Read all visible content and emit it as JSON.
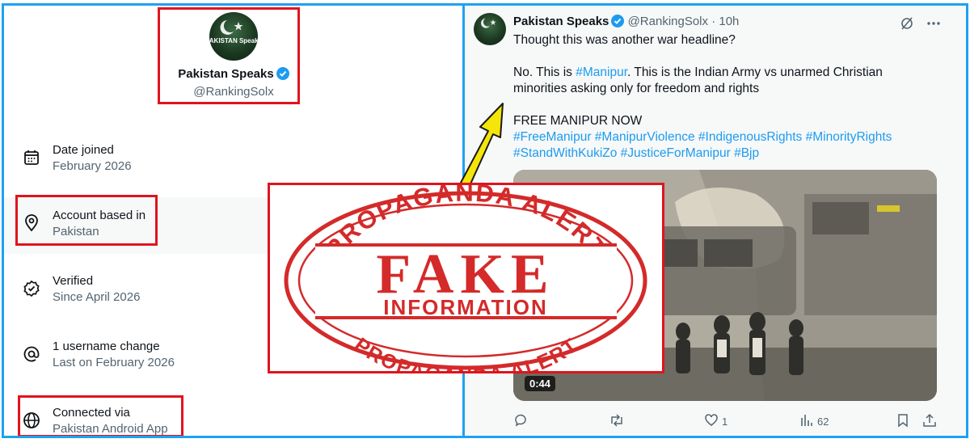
{
  "profile": {
    "avatar_text": "PAKISTAN Speaks",
    "name": "Pakistan Speaks",
    "handle": "@RankingSolx"
  },
  "about_rows": [
    {
      "icon": "calendar-icon",
      "label": "Date joined",
      "value": "February 2026"
    },
    {
      "icon": "location-pin-icon",
      "label": "Account based in",
      "value": "Pakistan"
    },
    {
      "icon": "verified-check-icon",
      "label": "Verified",
      "value": "Since April 2026"
    },
    {
      "icon": "at-sign-icon",
      "label": "1 username change",
      "value": "Last on February 2026"
    },
    {
      "icon": "globe-icon",
      "label": "Connected via",
      "value": "Pakistan Android App"
    }
  ],
  "tweet": {
    "name": "Pakistan Speaks",
    "handle": "@RankingSolx",
    "separator": "·",
    "time": "10h",
    "line1": "Thought this was another war headline?",
    "line2_pre": "No. This is ",
    "line2_tag": "#Manipur",
    "line2_post": ". This is the Indian Army vs unarmed Christian",
    "line3": "minorities asking only for freedom and rights",
    "line4": "FREE MANIPUR NOW",
    "hashtags_line1": "#FreeManipur #ManipurViolence #IndigenousRights #MinorityRights",
    "hashtags_line2": "#StandWithKukiZo #JusticeForManipur #Bjp",
    "video_duration": "0:44",
    "likes": "1",
    "views": "62"
  },
  "stamp": {
    "top_arc": "PROPAGANDA ALERT",
    "main": "FAKE",
    "sub": "INFORMATION",
    "bottom_arc": "PROPAGANDA ALERT"
  },
  "colors": {
    "frame_blue": "#1ea1f1",
    "highlight_red": "#e0141e",
    "stamp_red": "#d42a2a",
    "verified_blue": "#1d9bf0",
    "arrow_yellow": "#f5e50a",
    "muted_text": "#536471"
  }
}
